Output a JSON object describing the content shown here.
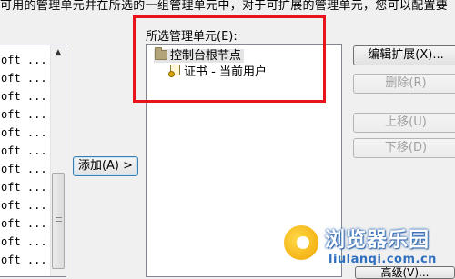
{
  "top_instruction": "可用的管理单元并在所选的一组管理单元中，对于可扩展的管理单元，您可以配置要",
  "available_snapins": {
    "rows": [
      "oft ...",
      "oft ...",
      "oft ...",
      "oft ...",
      "oft ...",
      "oft ...",
      "oft ...",
      "oft ...",
      "oft ...",
      "oft ...",
      "oft ...",
      "oft ..."
    ]
  },
  "add_button": {
    "label": "添加(A) >"
  },
  "selected_snapins": {
    "label": "所选管理单元(E):",
    "root": "控制台根节点",
    "child": "证书 - 当前用户"
  },
  "actions": {
    "edit_extensions": "编辑扩展(X)...",
    "remove": "删除(R)",
    "move_up": "上移(U)",
    "move_down": "下移(D)",
    "advanced": "高级(V)..."
  },
  "watermark": {
    "title": "浏览器乐园",
    "domain": "liulanqi.com.cn"
  },
  "colors": {
    "highlight": "#e8141c",
    "watermark_blue": "#2f6fbf"
  }
}
